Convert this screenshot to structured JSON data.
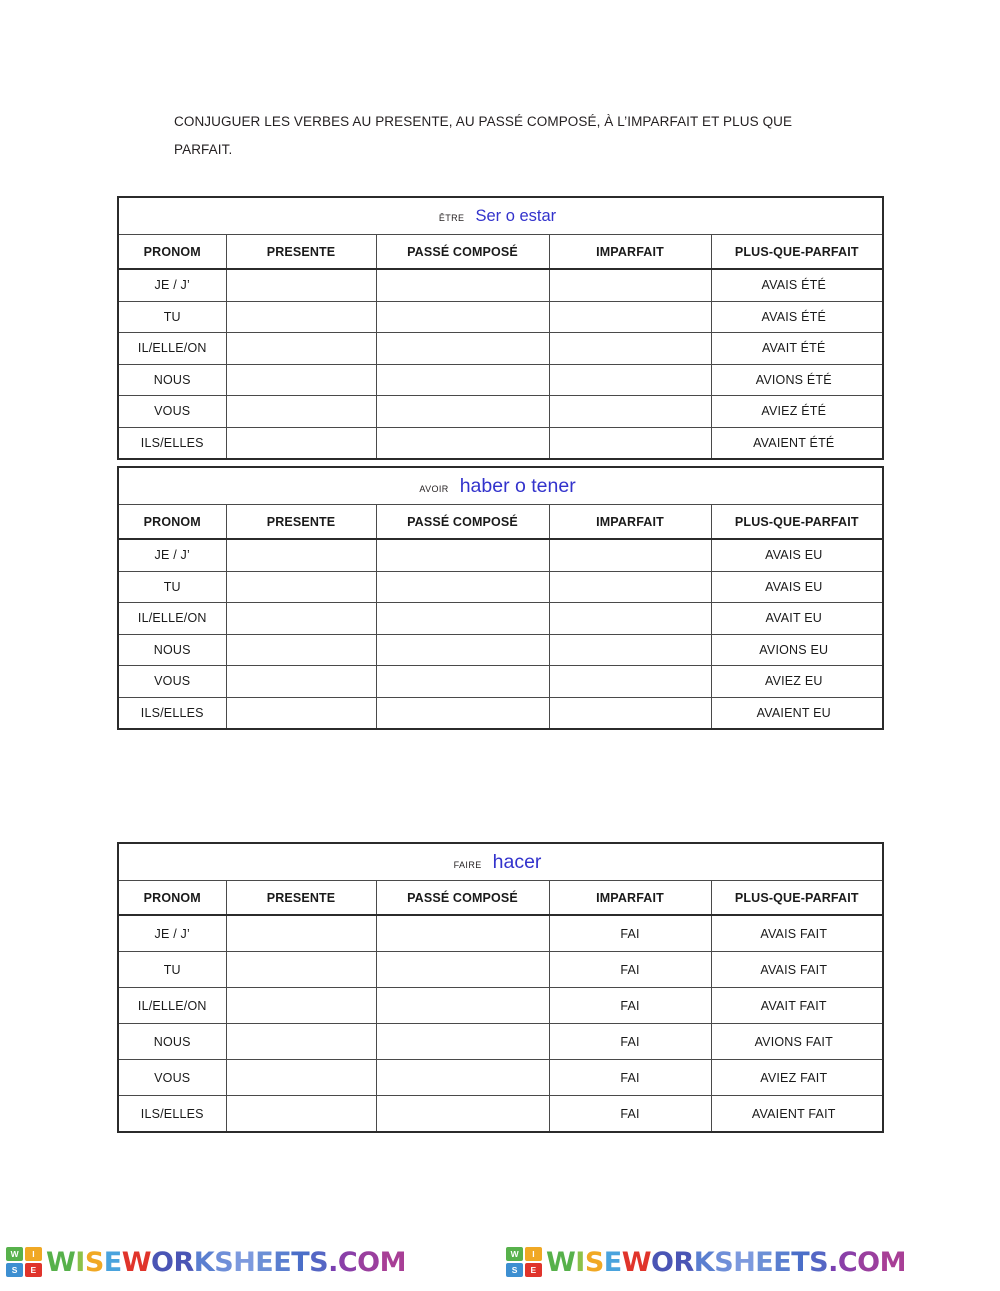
{
  "instruction": "CONJUGUER LES VERBES AU PRESENTE, AU PASSÉ COMPOSÉ,  À L’IMPARFAIT ET PLUS QUE PARFAIT.",
  "colors": {
    "translation_blue": "#3333cc",
    "table_border": "#2b2b2b",
    "text": "#1a1a1a"
  },
  "columns": {
    "pronom": "PRONOM",
    "presente": "PRESENTE",
    "passe_compose": "PASSÉ COMPOSÉ",
    "imparfait": "IMPARFAIT",
    "plus_que_parfait": "PLUS-QUE-PARFAIT"
  },
  "tables": [
    {
      "id": "etre",
      "verb_fr": "ÊTRE",
      "verb_es": "Ser o estar",
      "rows": [
        {
          "pronom": "JE / J’",
          "presente": "",
          "passe_compose": "",
          "imparfait": "",
          "plus_que_parfait": "AVAIS ÉTÉ"
        },
        {
          "pronom": "TU",
          "presente": "",
          "passe_compose": "",
          "imparfait": "",
          "plus_que_parfait": "AVAIS ÉTÉ"
        },
        {
          "pronom": "IL/ELLE/ON",
          "presente": "",
          "passe_compose": "",
          "imparfait": "",
          "plus_que_parfait": "AVAIT ÉTÉ"
        },
        {
          "pronom": "NOUS",
          "presente": "",
          "passe_compose": "",
          "imparfait": "",
          "plus_que_parfait": "AVIONS ÉTÉ"
        },
        {
          "pronom": "VOUS",
          "presente": "",
          "passe_compose": "",
          "imparfait": "",
          "plus_que_parfait": "AVIEZ ÉTÉ"
        },
        {
          "pronom": "ILS/ELLES",
          "presente": "",
          "passe_compose": "",
          "imparfait": "",
          "plus_que_parfait": "AVAIENT ÉTÉ"
        }
      ]
    },
    {
      "id": "avoir",
      "verb_fr": "AVOIR",
      "verb_es": "haber o tener",
      "rows": [
        {
          "pronom": "JE / J’",
          "presente": "",
          "passe_compose": "",
          "imparfait": "",
          "plus_que_parfait": "AVAIS EU"
        },
        {
          "pronom": "TU",
          "presente": "",
          "passe_compose": "",
          "imparfait": "",
          "plus_que_parfait": "AVAIS EU"
        },
        {
          "pronom": "IL/ELLE/ON",
          "presente": "",
          "passe_compose": "",
          "imparfait": "",
          "plus_que_parfait": "AVAIT EU"
        },
        {
          "pronom": "NOUS",
          "presente": "",
          "passe_compose": "",
          "imparfait": "",
          "plus_que_parfait": "AVIONS EU"
        },
        {
          "pronom": "VOUS",
          "presente": "",
          "passe_compose": "",
          "imparfait": "",
          "plus_que_parfait": "AVIEZ EU"
        },
        {
          "pronom": "ILS/ELLES",
          "presente": "",
          "passe_compose": "",
          "imparfait": "",
          "plus_que_parfait": "AVAIENT EU"
        }
      ]
    },
    {
      "id": "faire",
      "verb_fr": "FAIRE",
      "verb_es": "hacer",
      "rows": [
        {
          "pronom": "JE / J’",
          "presente": "",
          "passe_compose": "",
          "imparfait": "FAI",
          "plus_que_parfait": "AVAIS FAIT"
        },
        {
          "pronom": "TU",
          "presente": "",
          "passe_compose": "",
          "imparfait": "FAI",
          "plus_que_parfait": "AVAIS FAIT"
        },
        {
          "pronom": "IL/ELLE/ON",
          "presente": "",
          "passe_compose": "",
          "imparfait": "FAI",
          "plus_que_parfait": "AVAIT FAIT"
        },
        {
          "pronom": "NOUS",
          "presente": "",
          "passe_compose": "",
          "imparfait": "FAI",
          "plus_que_parfait": "AVIONS FAIT"
        },
        {
          "pronom": "VOUS",
          "presente": "",
          "passe_compose": "",
          "imparfait": "FAI",
          "plus_que_parfait": "AVIEZ FAIT"
        },
        {
          "pronom": "ILS/ELLES",
          "presente": "",
          "passe_compose": "",
          "imparfait": "FAI",
          "plus_que_parfait": "AVAIENT FAIT"
        }
      ]
    }
  ],
  "watermark": {
    "repeat": 2,
    "badge_letters": [
      {
        "letter": "W",
        "color": "#57b14b"
      },
      {
        "letter": "I",
        "color": "#f0a824"
      },
      {
        "letter": "S",
        "color": "#3d8fd1"
      },
      {
        "letter": "E",
        "color": "#e0342b"
      }
    ],
    "text": "WISEWORKSHEETS.COM",
    "letter_colors": [
      "#57b14b",
      "#8cc24a",
      "#f0a824",
      "#4aa3dd",
      "#e0342b",
      "#4a55b5",
      "#4a55b5",
      "#5a7fd0",
      "#6f8fd8",
      "#7d9ade",
      "#6b8fd6",
      "#5a7fd0",
      "#4a6ec8",
      "#5566c4",
      "#7a3fb0",
      "#8a3fa8",
      "#9a3f9e",
      "#a83f96",
      "#b43f8e"
    ]
  }
}
